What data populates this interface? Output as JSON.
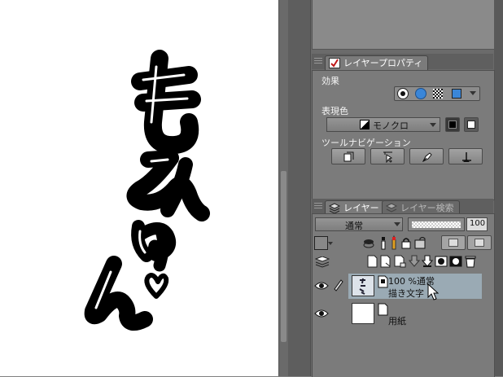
{
  "canvas": {
    "artwork_description_icon": "handwritten-momyun-artwork"
  },
  "layer_property_panel": {
    "tab_label": "レイヤープロパティ",
    "effect_label": "効果",
    "expression_color_label": "表現色",
    "expression_color_value": "モノクロ",
    "tool_navigation_label": "ツールナビゲーション"
  },
  "layer_panel": {
    "tab_layer": "レイヤー",
    "tab_layer_search": "レイヤー検索",
    "blend_mode": "通常",
    "opacity_value": "100",
    "layers": [
      {
        "opacity_blend": "100 %通常",
        "name": "描き文字",
        "selected": true
      },
      {
        "opacity_blend": "",
        "name": "用紙",
        "selected": false
      }
    ]
  },
  "colors": {
    "selected_layer": "#9aaab4",
    "accent_blue": "#3a86d8"
  }
}
